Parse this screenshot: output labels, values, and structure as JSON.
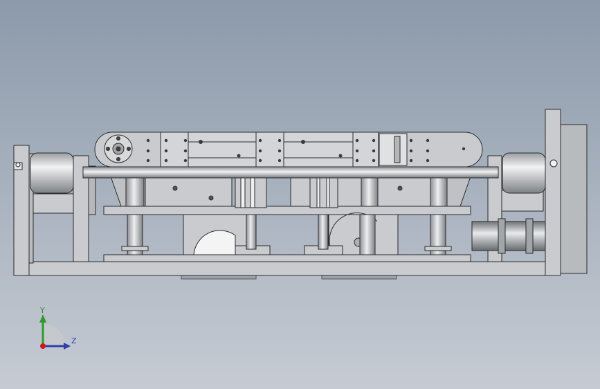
{
  "view": {
    "background_top": "#8c9aab",
    "background_bottom": "#c6cbd3",
    "part_fill": "#c9cbce",
    "part_stroke": "#2a2a2a"
  },
  "triad": {
    "y_label": "Y",
    "z_label": "Z",
    "y_color": "#2e9a2e",
    "z_color": "#2f3ea8",
    "origin_color": "#d01818"
  }
}
